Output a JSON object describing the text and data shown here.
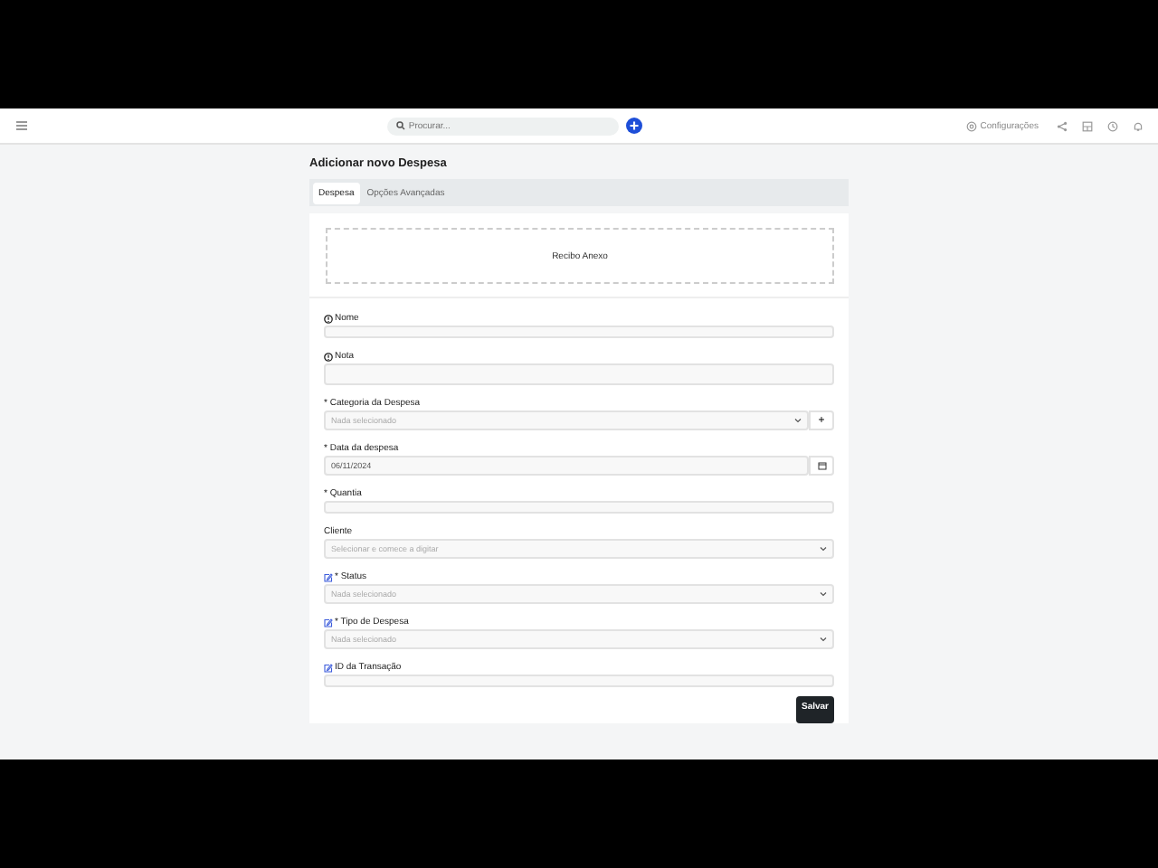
{
  "topbar": {
    "search": {
      "placeholder": "Procurar..."
    },
    "settings_label": "Configurações"
  },
  "page_title": "Adicionar novo Despesa",
  "tabs": [
    {
      "label": "Despesa",
      "selected": true
    },
    {
      "label": "Opções Avançadas",
      "selected": false
    }
  ],
  "dropzone": {
    "label": "Recibo Anexo"
  },
  "fields": [
    {
      "kind": "text",
      "label": "Nome",
      "info": true,
      "editable": false
    },
    {
      "kind": "textarea",
      "label": "Nota",
      "info": true,
      "editable": false
    },
    {
      "kind": "select-add",
      "label": "* Categoria da Despesa",
      "info": false,
      "editable": false,
      "placeholder": "Nada selecionado",
      "add": "+"
    },
    {
      "kind": "date",
      "label": "* Data da despesa",
      "info": false,
      "editable": false,
      "value": "06/11/2024"
    },
    {
      "kind": "text",
      "label": "* Quantia",
      "info": false,
      "editable": false
    },
    {
      "kind": "select",
      "label": "Cliente",
      "info": false,
      "editable": false,
      "placeholder": "Selecionar e comece a digitar"
    },
    {
      "kind": "select",
      "label": "* Status",
      "info": false,
      "editable": true,
      "placeholder": "Nada selecionado"
    },
    {
      "kind": "select",
      "label": "* Tipo de Despesa",
      "info": false,
      "editable": true,
      "placeholder": "Nada selecionado"
    },
    {
      "kind": "text",
      "label": "ID da Transação",
      "info": false,
      "editable": true
    }
  ],
  "save_button": "Salvar"
}
